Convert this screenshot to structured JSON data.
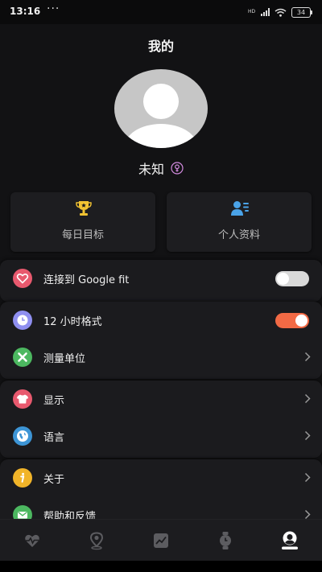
{
  "status_bar": {
    "time": "13:16",
    "dots": "···",
    "network": "HD",
    "battery": "34"
  },
  "header": {
    "title": "我的",
    "username": "未知"
  },
  "quick_cards": [
    {
      "label": "每日目标",
      "icon": "trophy-icon"
    },
    {
      "label": "个人资料",
      "icon": "profile-card-icon"
    }
  ],
  "settings": {
    "google_fit": {
      "label": "连接到 Google fit",
      "icon": "heart-link-icon",
      "enabled": false
    },
    "time_format": {
      "label": "12 小时格式",
      "icon": "clock-icon",
      "enabled": true
    },
    "units": {
      "label": "测量单位",
      "icon": "measure-icon"
    },
    "display": {
      "label": "显示",
      "icon": "shirt-icon"
    },
    "language": {
      "label": "语言",
      "icon": "globe-icon"
    },
    "about": {
      "label": "关于",
      "icon": "info-icon"
    },
    "help": {
      "label": "帮助和反馈",
      "icon": "mail-icon"
    }
  },
  "colors": {
    "accent_toggle_on": "#f26a45",
    "gender_icon": "#d38be0",
    "trophy": "#f1c232",
    "profile_icon": "#4aa3e8"
  },
  "bottom_nav": [
    {
      "name": "heart-rate-tab",
      "icon": "heart-pulse-icon"
    },
    {
      "name": "location-tab",
      "icon": "location-pin-icon"
    },
    {
      "name": "trend-tab",
      "icon": "trend-chart-icon"
    },
    {
      "name": "watch-tab",
      "icon": "watch-icon"
    },
    {
      "name": "profile-tab",
      "icon": "user-icon",
      "active": true
    }
  ]
}
